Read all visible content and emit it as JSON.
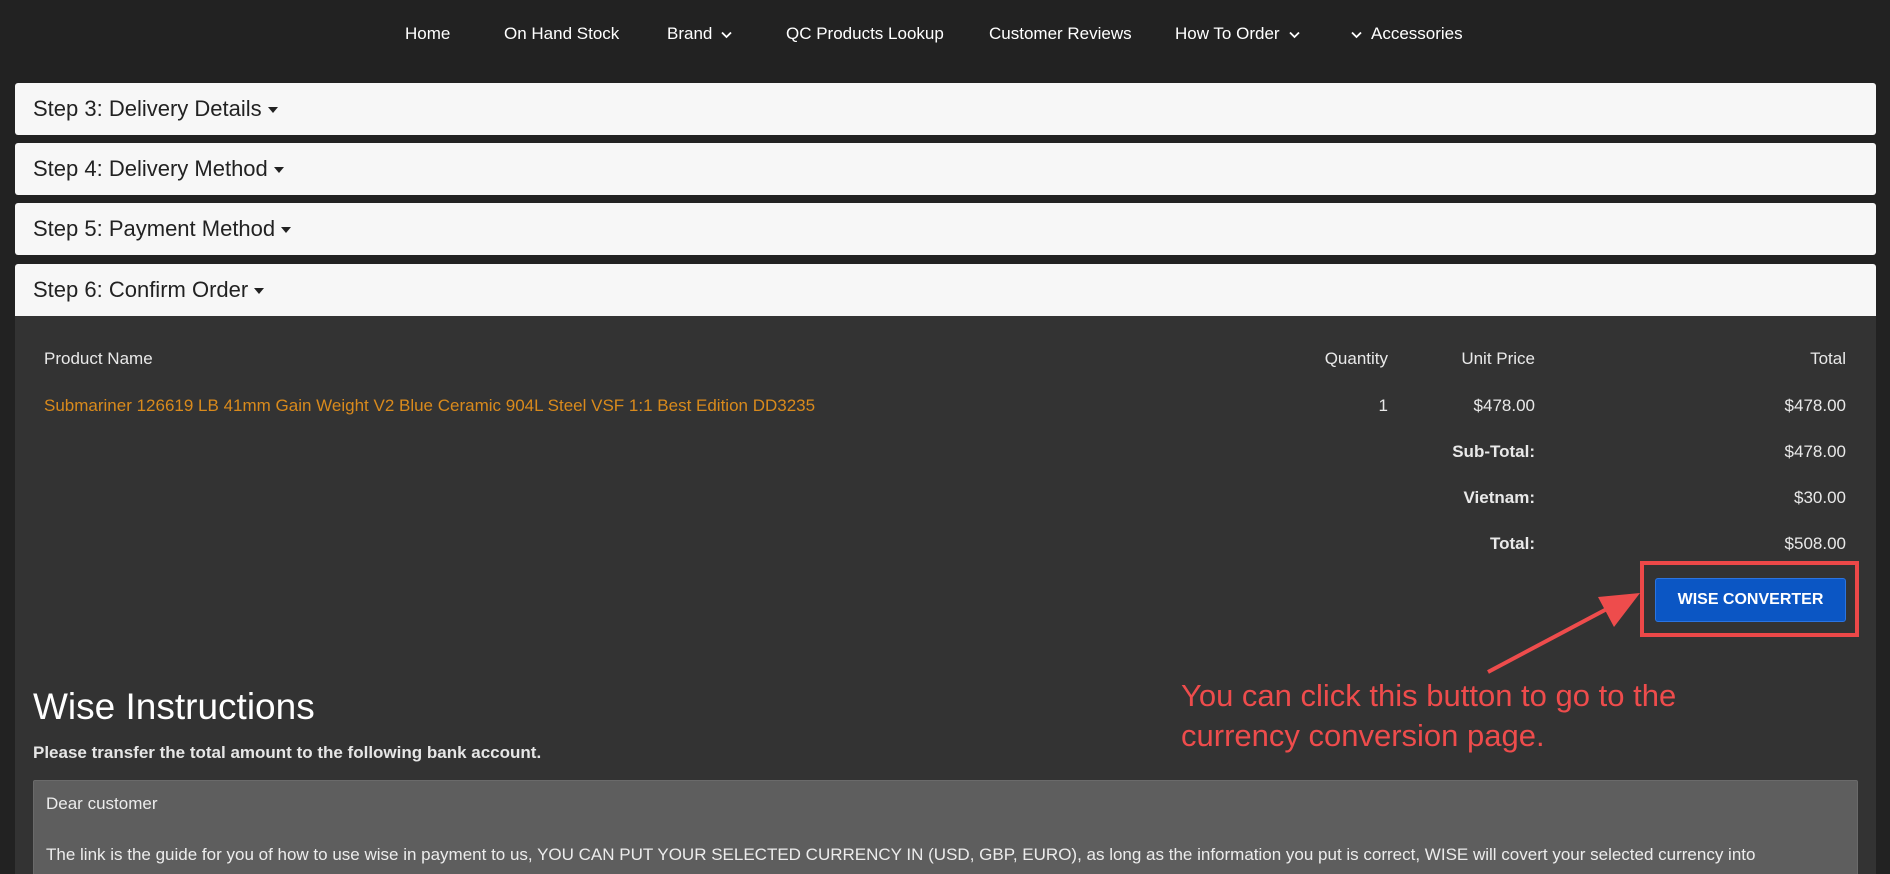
{
  "nav": {
    "home": "Home",
    "on_hand_stock": "On Hand Stock",
    "brand": "Brand",
    "qc_lookup": "QC Products Lookup",
    "reviews": "Customer Reviews",
    "how_to_order": "How To Order",
    "accessories": "Accessories"
  },
  "steps": {
    "step3": "Step 3: Delivery Details",
    "step4": "Step 4: Delivery Method",
    "step5": "Step 5: Payment Method",
    "step6": "Step 6: Confirm Order"
  },
  "table": {
    "headers": {
      "product_name": "Product Name",
      "quantity": "Quantity",
      "unit_price": "Unit Price",
      "total": "Total"
    },
    "row": {
      "product": "Submariner 126619 LB 41mm Gain Weight V2 Blue Ceramic 904L Steel VSF 1:1 Best Edition DD3235",
      "quantity": "1",
      "unit_price": "$478.00",
      "total": "$478.00"
    },
    "totals": {
      "subtotal_label": "Sub-Total:",
      "subtotal_value": "$478.00",
      "shipping_label": "Vietnam:",
      "shipping_value": "$30.00",
      "total_label": "Total:",
      "total_value": "$508.00"
    }
  },
  "wise_button": "WISE CONVERTER",
  "annotation": "You can click this button to go to the currency conversion page.",
  "wise": {
    "title": "Wise Instructions",
    "subtitle": "Please transfer the total amount to the following bank account.",
    "greeting": "Dear customer",
    "body": "The link is the guide for you of how to use wise in payment to us, YOU CAN PUT YOUR SELECTED CURRENCY IN (USD, GBP, EURO), as long as the information you put is correct, WISE will covert your selected currency into"
  },
  "colors": {
    "link": "#d98a1c",
    "button": "#0b56c4",
    "annotation": "#ee4c4c"
  },
  "icons": [
    "chevron-down-icon",
    "caret-down-icon",
    "arrow-annotation"
  ]
}
